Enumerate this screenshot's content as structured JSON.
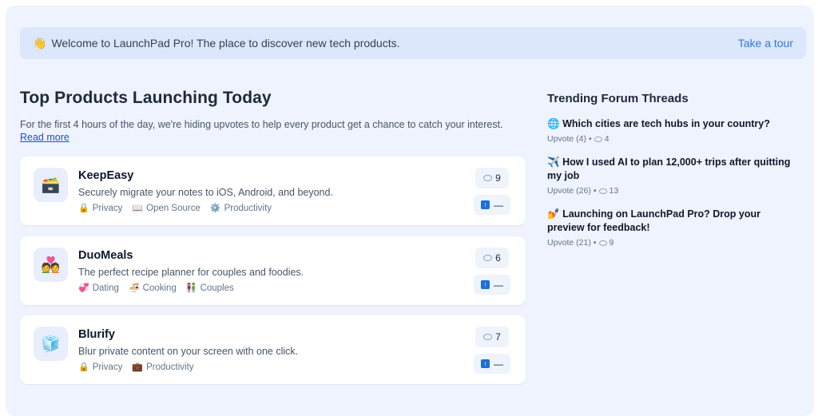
{
  "banner": {
    "icon": "waving-hand-icon",
    "icon_glyph": "👋",
    "text": "Welcome to LaunchPad Pro! The place to discover new tech products.",
    "link": "Take a tour"
  },
  "main": {
    "title": "Top Products Launching Today",
    "subtitle": "For the first 4 hours of the day, we're hiding upvotes to help every product get a chance to catch your interest.",
    "read_more": "Read more"
  },
  "products": [
    {
      "name": "KeepEasy",
      "description": "Securely migrate your notes to iOS, Android, and beyond.",
      "icon": "file-box-icon",
      "icon_glyph": "🗃️",
      "comments": "9",
      "upvotes": "—",
      "tags": [
        {
          "icon_glyph": "🔒",
          "label": "Privacy"
        },
        {
          "icon_glyph": "📖",
          "label": "Open Source"
        },
        {
          "icon_glyph": "⚙️",
          "label": "Productivity"
        }
      ]
    },
    {
      "name": "DuoMeals",
      "description": "The perfect recipe planner for couples and foodies.",
      "icon": "couple-heart-icon",
      "icon_glyph": "💑",
      "comments": "6",
      "upvotes": "—",
      "tags": [
        {
          "icon_glyph": "💞",
          "label": "Dating"
        },
        {
          "icon_glyph": "🍜",
          "label": "Cooking"
        },
        {
          "icon_glyph": "👫",
          "label": "Couples"
        }
      ]
    },
    {
      "name": "Blurify",
      "description": "Blur private content on your screen with one click.",
      "icon": "cube-icon",
      "icon_glyph": "🧊",
      "comments": "7",
      "upvotes": "—",
      "tags": [
        {
          "icon_glyph": "🔒",
          "label": "Privacy"
        },
        {
          "icon_glyph": "💼",
          "label": "Productivity"
        }
      ]
    }
  ],
  "sidebar": {
    "title": "Trending Forum Threads",
    "threads": [
      {
        "icon_glyph": "🌐",
        "title": "Which cities are tech hubs in your country?",
        "upvote": "Upvote (4)",
        "comments": "4"
      },
      {
        "icon_glyph": "✈️",
        "title": "How I used AI to plan 12,000+ trips after quitting my job",
        "upvote": "Upvote (26)",
        "comments": "13"
      },
      {
        "icon_glyph": "💅",
        "title": "Launching on LaunchPad Pro? Drop your preview for feedback!",
        "upvote": "Upvote (21)",
        "comments": "9"
      }
    ]
  },
  "colors": {
    "background": "#eef3fd",
    "banner": "#dce7fb",
    "link": "#2f7ad6",
    "upvote_accent": "#1d6fd8"
  }
}
